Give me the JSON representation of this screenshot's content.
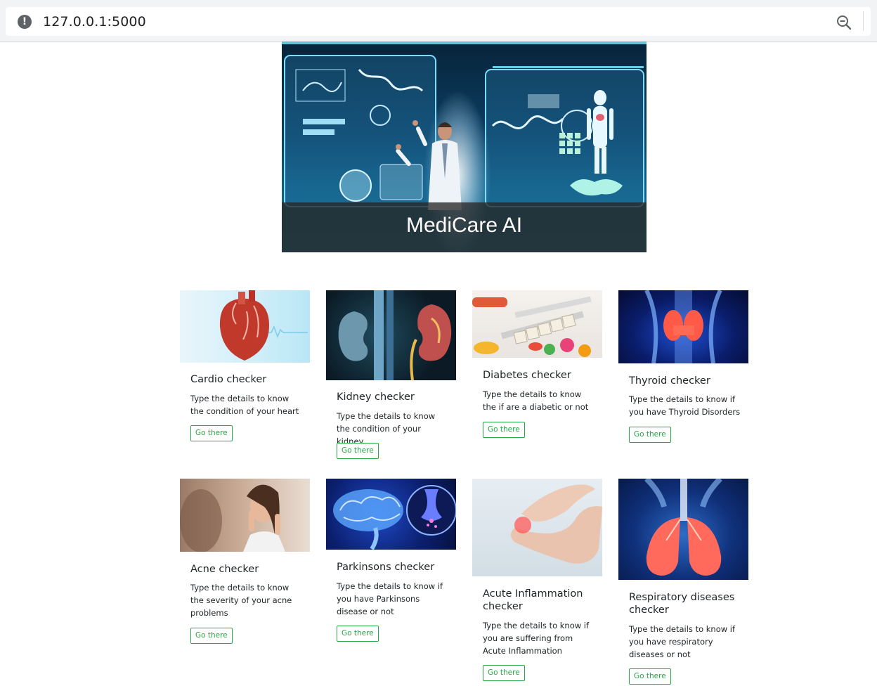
{
  "browser": {
    "url": "127.0.0.1:5000"
  },
  "hero": {
    "caption": "MediCare AI"
  },
  "cards": [
    {
      "title": "Cardio checker",
      "text": "Type the details to know the condition of your heart",
      "button": "Go there",
      "image_icon": "heart-image"
    },
    {
      "title": "Kidney checker",
      "text": "Type the details to know the condition of your kidney",
      "button": "Go there",
      "image_icon": "kidney-image"
    },
    {
      "title": "Diabetes checker",
      "text": "Type the details to know the if are a diabetic or not",
      "button": "Go there",
      "image_icon": "diabetes-image"
    },
    {
      "title": "Thyroid checker",
      "text": "Type the details to know if you have Thyroid Disorders",
      "button": "Go there",
      "image_icon": "thyroid-image"
    },
    {
      "title": "Acne checker",
      "text": "Type the details to know the severity of your acne problems",
      "button": "Go there",
      "image_icon": "acne-image"
    },
    {
      "title": "Parkinsons checker",
      "text": "Type the details to know if you have Parkinsons disease or not",
      "button": "Go there",
      "image_icon": "brain-image"
    },
    {
      "title": "Acute Inflammation checker",
      "text": "Type the details to know if you are suffering from Acute Inflammation",
      "button": "Go there",
      "image_icon": "foot-image"
    },
    {
      "title": "Respiratory diseases checker",
      "text": "Type the details to know if you have respiratory diseases or not",
      "button": "Go there",
      "image_icon": "lungs-image"
    }
  ],
  "colors": {
    "button_accent": "#28a745",
    "hero_caption_bg": "#262626"
  }
}
